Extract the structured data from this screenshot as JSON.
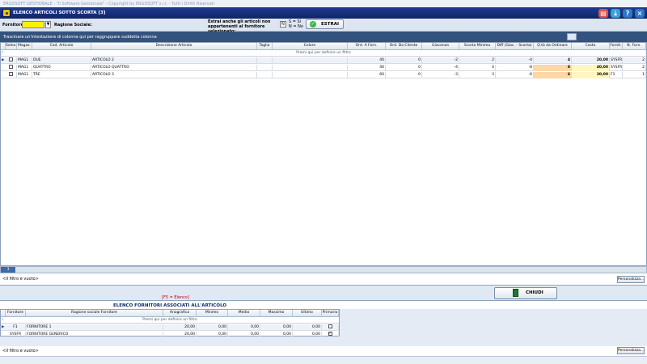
{
  "app": {
    "window_title_bar": "ERGOSOFT GESTIONALE - \"Il Software Gestionale\" - Copyright by ERGOSOFT s.r.l. - Tutti i Diritti Riservati",
    "form_title": "ELENCO ARTICOLI SOTTO SCORTA [3]"
  },
  "filters": {
    "fornitore_label": "Fornitore:",
    "fornitore_value": "",
    "ragione_sociale_label": "Ragione Sociale:",
    "estrai_description": "Estrai anche gli articoli non appartenenti al fornitore selezionato:",
    "estrai_check": "N",
    "si_legend": "S = Sì",
    "no_legend": "N = No",
    "estrai_button": "ESTRAI"
  },
  "grouping_hint": "Trascinare un'intestazione di colonna qui per raggruppare suddetta colonna",
  "grid1": {
    "filter_placeholder": "Premi qui per definire un filtro",
    "columns": [
      "Seleo.",
      "Magaz.",
      "Cod. Articolo",
      "Descrizione Articolo",
      "Taglia",
      "Colore",
      "Ord. A Forn.",
      "Ord. Da Cliente",
      "Giacenza",
      "Scorta Minima",
      "Diff (Giac. - Scorta)",
      "Q.tà da Ordinare",
      "Costo",
      "Fornit.",
      "N. Forn."
    ],
    "rows": [
      {
        "mag": "MAG1",
        "cod": "DUE",
        "desc": "ARTICOLO 2",
        "taglia": "",
        "colore": "",
        "ord_forn": "40",
        "ord_cli": "0",
        "giac": "-2",
        "scorta": "2",
        "diff": "-4",
        "qta": "4",
        "costo": "20,00",
        "fornit": "SYSFR",
        "nforn": "2"
      },
      {
        "mag": "MAG1",
        "cod": "QUATTRO",
        "desc": "ARTICOLO QUATTRO",
        "taglia": "",
        "colore": "",
        "ord_forn": "40",
        "ord_cli": "0",
        "giac": "-4",
        "scorta": "4",
        "diff": "-8",
        "qta": "8",
        "costo": "40,00",
        "fornit": "SYSFR",
        "nforn": "2"
      },
      {
        "mag": "MAG1",
        "cod": "TRE",
        "desc": "ARTICOLO 3",
        "taglia": "",
        "colore": "",
        "ord_forn": "60",
        "ord_cli": "0",
        "giac": "-3",
        "scorta": "3",
        "diff": "-6",
        "qta": "6",
        "costo": "30,00",
        "fornit": "F1",
        "nforn": "1"
      }
    ],
    "count": "3",
    "filter_status": "<Il filtro è vuoto>",
    "personalizza": "Personalizza..."
  },
  "f5_label": "[F5 = Elenco]",
  "chiudi_button": "CHIUDI",
  "grid2": {
    "title": "ELENCO FORNITORI ASSOCIATI ALL'ARTICOLO",
    "filter_placeholder": "Premi qui per definire un filtro",
    "columns": [
      "Fornitore",
      "Ragione sociale Fornitore",
      "Anagrafica",
      "Minimo",
      "Medio",
      "Massimo",
      "Ultimo",
      "Primario"
    ],
    "rows": [
      {
        "forn": "F1",
        "rag": "FORNITORE 1",
        "anag": "20,00",
        "min": "0,00",
        "med": "0,00",
        "max": "0,00",
        "ult": "0,00",
        "primario": false
      },
      {
        "forn": "SYSFR",
        "rag": "FORNITORE GENERICO",
        "anag": "20,00",
        "min": "0,00",
        "med": "0,00",
        "max": "0,00",
        "ult": "0,00",
        "primario": true
      }
    ],
    "filter_status": "<Il filtro è vuoto>",
    "personalizza": "Personalizza..."
  },
  "colors": {
    "header": "#1e3c91",
    "fornitore_input": "#ffef00",
    "qta_highlight": "#fcd7a8",
    "costo_highlight": "#fff6c2",
    "f5_text": "#c00000"
  }
}
